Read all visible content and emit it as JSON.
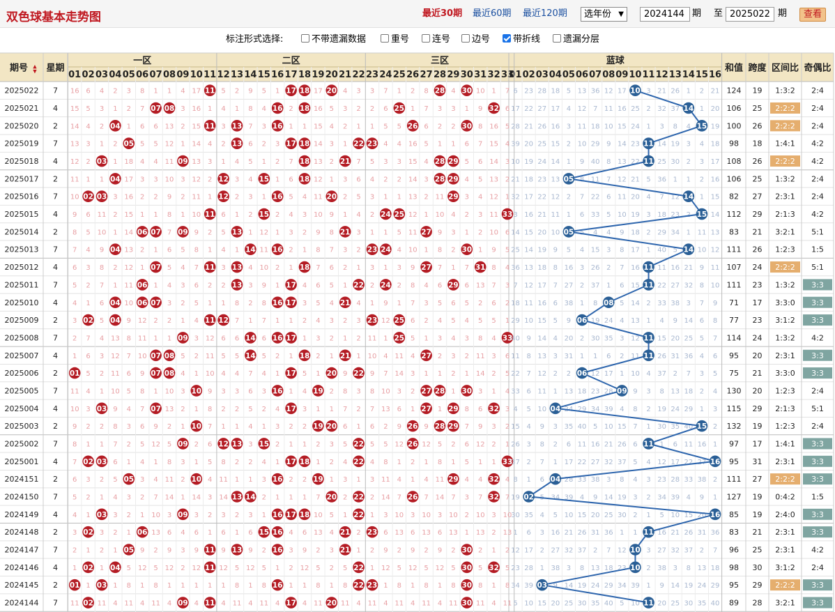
{
  "header": {
    "title": "双色球基本走势图",
    "period_links": [
      "最近30期",
      "最近60期",
      "最近120期"
    ],
    "year_select": "选年份",
    "from_value": "2024144",
    "unit_label_1": "期",
    "to_label": "至",
    "to_value": "2025022",
    "unit_label_2": "期",
    "view_button": "查看"
  },
  "options": {
    "label": "标注形式选择:",
    "items": [
      {
        "label": "不带遗漏数据",
        "checked": false
      },
      {
        "label": "重号",
        "checked": false
      },
      {
        "label": "连号",
        "checked": false
      },
      {
        "label": "边号",
        "checked": false
      },
      {
        "label": "带折线",
        "checked": true
      },
      {
        "label": "遗漏分层",
        "checked": false
      }
    ]
  },
  "table": {
    "headers": {
      "issue": "期号",
      "weekday": "星期",
      "zone1": "一区",
      "zone2": "二区",
      "zone3": "三区",
      "blue": "蓝球",
      "sum": "和值",
      "span": "跨度",
      "zone_ratio": "区间比",
      "odd_even": "奇偶比"
    },
    "red_numbers": [
      "01",
      "02",
      "03",
      "04",
      "05",
      "06",
      "07",
      "08",
      "09",
      "10",
      "11",
      "12",
      "13",
      "14",
      "15",
      "16",
      "17",
      "18",
      "19",
      "20",
      "21",
      "22",
      "23",
      "24",
      "25",
      "26",
      "27",
      "28",
      "29",
      "30",
      "31",
      "32",
      "33"
    ],
    "blue_numbers": [
      "01",
      "02",
      "03",
      "04",
      "05",
      "06",
      "07",
      "08",
      "09",
      "10",
      "11",
      "12",
      "13",
      "14",
      "15",
      "16"
    ],
    "colors": {
      "red_ball": "#b41c24",
      "blue_ball": "#2a5f96",
      "line": "#2d65ad",
      "ratio_gold": "#e5ae6e",
      "ratio_teal": "#7fa5a1",
      "header_bg": "#f2e6c4"
    },
    "rows": [
      {
        "issue": "2025022",
        "weekday": "7",
        "red": [
          11,
          17,
          18,
          20,
          28,
          30
        ],
        "blue": 10,
        "sum": "124",
        "span": "19",
        "zone_ratio": "1:3:2",
        "odd_even": "2:4",
        "zr_hl": false,
        "oe_hl": false
      },
      {
        "issue": "2025021",
        "weekday": "4",
        "red": [
          7,
          8,
          16,
          18,
          25,
          32
        ],
        "blue": 14,
        "sum": "106",
        "span": "25",
        "zone_ratio": "2:2:2",
        "odd_even": "2:4",
        "zr_hl": true,
        "oe_hl": false
      },
      {
        "issue": "2025020",
        "weekday": "2",
        "red": [
          4,
          11,
          13,
          16,
          26,
          30
        ],
        "blue": 15,
        "sum": "100",
        "span": "26",
        "zone_ratio": "2:2:2",
        "odd_even": "2:4",
        "zr_hl": true,
        "oe_hl": false
      },
      {
        "issue": "2025019",
        "weekday": "7",
        "red": [
          5,
          13,
          17,
          18,
          22,
          23
        ],
        "blue": 11,
        "sum": "98",
        "span": "18",
        "zone_ratio": "1:4:1",
        "odd_even": "4:2",
        "zr_hl": false,
        "oe_hl": false
      },
      {
        "issue": "2025018",
        "weekday": "4",
        "red": [
          3,
          9,
          18,
          21,
          28,
          29
        ],
        "blue": 11,
        "sum": "108",
        "span": "26",
        "zone_ratio": "2:2:2",
        "odd_even": "4:2",
        "zr_hl": true,
        "oe_hl": false
      },
      {
        "issue": "2025017",
        "weekday": "2",
        "red": [
          4,
          12,
          15,
          18,
          28,
          29
        ],
        "blue": 5,
        "sum": "106",
        "span": "25",
        "zone_ratio": "1:3:2",
        "odd_even": "2:4",
        "zr_hl": false,
        "oe_hl": false
      },
      {
        "issue": "2025016",
        "weekday": "7",
        "red": [
          2,
          3,
          12,
          16,
          20,
          29
        ],
        "blue": 14,
        "sum": "82",
        "span": "27",
        "zone_ratio": "2:3:1",
        "odd_even": "2:4",
        "zr_hl": false,
        "oe_hl": false
      },
      {
        "issue": "2025015",
        "weekday": "4",
        "red": [
          11,
          15,
          24,
          25,
          33
        ],
        "blue": 15,
        "sum": "112",
        "span": "29",
        "zone_ratio": "2:1:3",
        "odd_even": "4:2",
        "zr_hl": false,
        "oe_hl": false
      },
      {
        "issue": "2025014",
        "weekday": "2",
        "red": [
          6,
          7,
          9,
          13,
          21,
          27
        ],
        "blue": 5,
        "sum": "83",
        "span": "21",
        "zone_ratio": "3:2:1",
        "odd_even": "5:1",
        "zr_hl": false,
        "oe_hl": false
      },
      {
        "issue": "2025013",
        "weekday": "7",
        "red": [
          4,
          14,
          16,
          23,
          24,
          30
        ],
        "blue": 14,
        "sum": "111",
        "span": "26",
        "zone_ratio": "1:2:3",
        "odd_even": "1:5",
        "zr_hl": false,
        "oe_hl": false
      },
      {
        "issue": "2025012",
        "weekday": "4",
        "red": [
          7,
          11,
          13,
          18,
          27,
          31
        ],
        "blue": 11,
        "sum": "107",
        "span": "24",
        "zone_ratio": "2:2:2",
        "odd_even": "5:1",
        "zr_hl": true,
        "oe_hl": false
      },
      {
        "issue": "2025011",
        "weekday": "7",
        "red": [
          6,
          13,
          17,
          22,
          24,
          29
        ],
        "blue": 11,
        "sum": "111",
        "span": "23",
        "zone_ratio": "1:3:2",
        "odd_even": "3:3",
        "zr_hl": false,
        "oe_hl": true
      },
      {
        "issue": "2025010",
        "weekday": "4",
        "red": [
          4,
          6,
          7,
          16,
          17,
          21
        ],
        "blue": 8,
        "sum": "71",
        "span": "17",
        "zone_ratio": "3:3:0",
        "odd_even": "3:3",
        "zr_hl": false,
        "oe_hl": true
      },
      {
        "issue": "2025009",
        "weekday": "2",
        "red": [
          2,
          4,
          11,
          12,
          23,
          25
        ],
        "blue": 6,
        "sum": "77",
        "span": "23",
        "zone_ratio": "3:1:2",
        "odd_even": "3:3",
        "zr_hl": false,
        "oe_hl": true
      },
      {
        "issue": "2025008",
        "weekday": "7",
        "red": [
          9,
          14,
          16,
          17,
          25,
          33
        ],
        "blue": 11,
        "sum": "114",
        "span": "24",
        "zone_ratio": "1:3:2",
        "odd_even": "4:2",
        "zr_hl": false,
        "oe_hl": false
      },
      {
        "issue": "2025007",
        "weekday": "4",
        "red": [
          7,
          8,
          14,
          18,
          21,
          27
        ],
        "blue": 11,
        "sum": "95",
        "span": "20",
        "zone_ratio": "2:3:1",
        "odd_even": "3:3",
        "zr_hl": false,
        "oe_hl": true
      },
      {
        "issue": "2025006",
        "weekday": "2",
        "red": [
          1,
          7,
          8,
          17,
          20,
          22
        ],
        "blue": 6,
        "sum": "75",
        "span": "21",
        "zone_ratio": "3:3:0",
        "odd_even": "3:3",
        "zr_hl": false,
        "oe_hl": true
      },
      {
        "issue": "2025005",
        "weekday": "7",
        "red": [
          10,
          16,
          19,
          27,
          28,
          30
        ],
        "blue": 9,
        "sum": "130",
        "span": "20",
        "zone_ratio": "1:2:3",
        "odd_even": "2:4",
        "zr_hl": false,
        "oe_hl": false
      },
      {
        "issue": "2025004",
        "weekday": "4",
        "red": [
          3,
          7,
          17,
          27,
          29,
          32
        ],
        "blue": 4,
        "sum": "115",
        "span": "29",
        "zone_ratio": "2:1:3",
        "odd_even": "5:1",
        "zr_hl": false,
        "oe_hl": false
      },
      {
        "issue": "2025003",
        "weekday": "2",
        "red": [
          10,
          19,
          20,
          26,
          28,
          29
        ],
        "blue": 15,
        "sum": "132",
        "span": "19",
        "zone_ratio": "1:2:3",
        "odd_even": "2:4",
        "zr_hl": false,
        "oe_hl": false
      },
      {
        "issue": "2025002",
        "weekday": "7",
        "red": [
          9,
          12,
          13,
          15,
          22,
          26
        ],
        "blue": 11,
        "sum": "97",
        "span": "17",
        "zone_ratio": "1:4:1",
        "odd_even": "3:3",
        "zr_hl": false,
        "oe_hl": true
      },
      {
        "issue": "2025001",
        "weekday": "4",
        "red": [
          2,
          3,
          17,
          18,
          22,
          33
        ],
        "blue": 16,
        "sum": "95",
        "span": "31",
        "zone_ratio": "2:3:1",
        "odd_even": "3:3",
        "zr_hl": false,
        "oe_hl": true
      },
      {
        "issue": "2024151",
        "weekday": "2",
        "red": [
          5,
          10,
          16,
          19,
          29,
          32
        ],
        "blue": 4,
        "sum": "111",
        "span": "27",
        "zone_ratio": "2:2:2",
        "odd_even": "3:3",
        "zr_hl": true,
        "oe_hl": true
      },
      {
        "issue": "2024150",
        "weekday": "7",
        "red": [
          13,
          14,
          20,
          22,
          26,
          32
        ],
        "blue": 2,
        "sum": "127",
        "span": "19",
        "zone_ratio": "0:4:2",
        "odd_even": "1:5",
        "zr_hl": false,
        "oe_hl": false
      },
      {
        "issue": "2024149",
        "weekday": "4",
        "red": [
          3,
          9,
          16,
          17,
          18,
          22
        ],
        "blue": 16,
        "sum": "85",
        "span": "19",
        "zone_ratio": "2:4:0",
        "odd_even": "3:3",
        "zr_hl": false,
        "oe_hl": true
      },
      {
        "issue": "2024148",
        "weekday": "2",
        "red": [
          2,
          6,
          15,
          16,
          21,
          23
        ],
        "blue": 11,
        "sum": "83",
        "span": "21",
        "zone_ratio": "2:3:1",
        "odd_even": "3:3",
        "zr_hl": false,
        "oe_hl": true
      },
      {
        "issue": "2024147",
        "weekday": "7",
        "red": [
          5,
          11,
          13,
          16,
          21,
          30
        ],
        "blue": 10,
        "sum": "96",
        "span": "25",
        "zone_ratio": "2:3:1",
        "odd_even": "4:2",
        "zr_hl": false,
        "oe_hl": false
      },
      {
        "issue": "2024146",
        "weekday": "4",
        "red": [
          2,
          4,
          11,
          22,
          30,
          32
        ],
        "blue": 10,
        "sum": "98",
        "span": "30",
        "zone_ratio": "3:1:2",
        "odd_even": "2:4",
        "zr_hl": false,
        "oe_hl": false
      },
      {
        "issue": "2024145",
        "weekday": "2",
        "red": [
          1,
          3,
          16,
          22,
          23,
          30
        ],
        "blue": 3,
        "sum": "95",
        "span": "29",
        "zone_ratio": "2:2:2",
        "odd_even": "3:3",
        "zr_hl": true,
        "oe_hl": true
      },
      {
        "issue": "2024144",
        "weekday": "7",
        "red": [
          2,
          9,
          11,
          17,
          20,
          30
        ],
        "blue": 11,
        "sum": "89",
        "span": "28",
        "zone_ratio": "3:2:1",
        "odd_even": "3:3",
        "zr_hl": false,
        "oe_hl": true
      }
    ]
  }
}
